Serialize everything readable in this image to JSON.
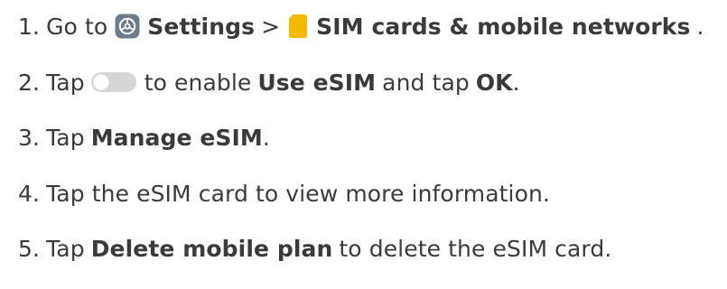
{
  "steps": [
    {
      "number": "1.",
      "pre": "Go to",
      "settings_label": "Settings",
      "separator": ">",
      "sim_label": "SIM cards & mobile networks",
      "post": "."
    },
    {
      "number": "2.",
      "pre": "Tap",
      "mid": "to enable",
      "bold1": "Use eSIM",
      "and": "and tap",
      "bold2": "OK",
      "post": "."
    },
    {
      "number": "3.",
      "pre": "Tap",
      "bold": "Manage eSIM",
      "post": "."
    },
    {
      "number": "4.",
      "text": "Tap the eSIM card to view more information."
    },
    {
      "number": "5.",
      "pre": "Tap",
      "bold": "Delete mobile plan",
      "post": "to delete the eSIM card."
    }
  ],
  "icons": {
    "settings": "settings-gear-icon",
    "sim": "sim-card-icon",
    "toggle": "toggle-switch-icon"
  },
  "colors": {
    "text": "#3b3b3b",
    "settings_icon_bg": "#6b7c8c",
    "sim_icon": "#f5b800",
    "toggle_track": "#d6d6d6"
  }
}
